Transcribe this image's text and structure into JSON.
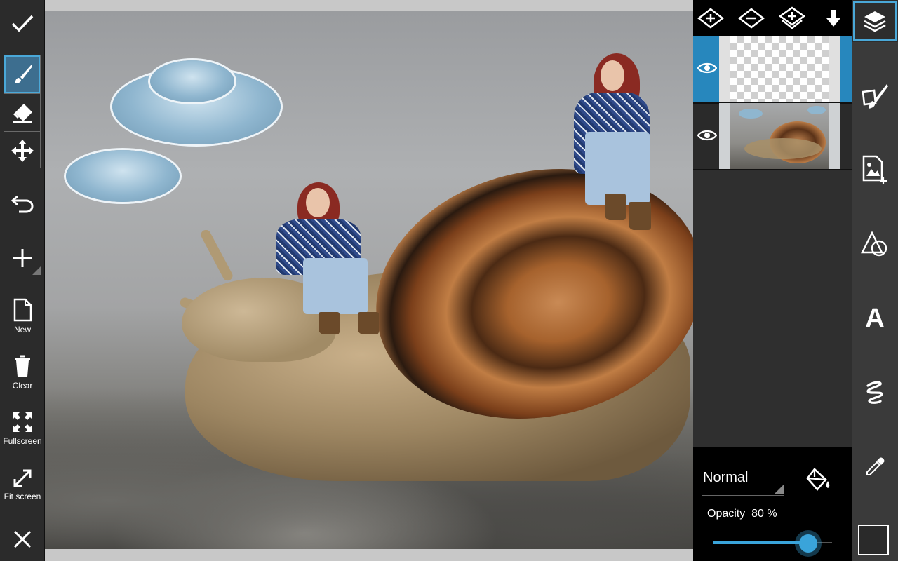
{
  "left_toolbar": {
    "confirm_icon": "check-icon",
    "tools": [
      {
        "name": "brush",
        "icon": "brush-icon",
        "active": true
      },
      {
        "name": "eraser",
        "icon": "eraser-icon",
        "active": false
      },
      {
        "name": "move",
        "icon": "move-icon",
        "active": false
      }
    ],
    "undo_icon": "undo-icon",
    "add_icon": "plus-icon",
    "new_label": "New",
    "clear_label": "Clear",
    "fullscreen_label": "Fullscreen",
    "fit_screen_label": "Fit screen",
    "close_icon": "close-icon"
  },
  "layers": {
    "toolbar_icons": [
      "add-layer-icon",
      "remove-layer-icon",
      "merge-layer-icon",
      "move-down-icon"
    ],
    "items": [
      {
        "name": "layer-1",
        "visible": true,
        "selected": true,
        "kind": "transparent"
      },
      {
        "name": "layer-2",
        "visible": true,
        "selected": false,
        "kind": "photo"
      }
    ],
    "blend_mode": "Normal",
    "opacity_label": "Opacity",
    "opacity_value": "80 %",
    "opacity_fraction": 0.8
  },
  "right_toolbar": {
    "items": [
      "layers-icon",
      "brush-tools-icon",
      "add-image-icon",
      "shapes-icon",
      "text-icon",
      "effects-icon",
      "eyedropper-icon"
    ],
    "text_tool_glyph": "A",
    "current_color": "#2a2a2a"
  },
  "colors": {
    "accent": "#2787bd",
    "highlight": "#4aa8d8",
    "slider": "#3aa4da"
  }
}
